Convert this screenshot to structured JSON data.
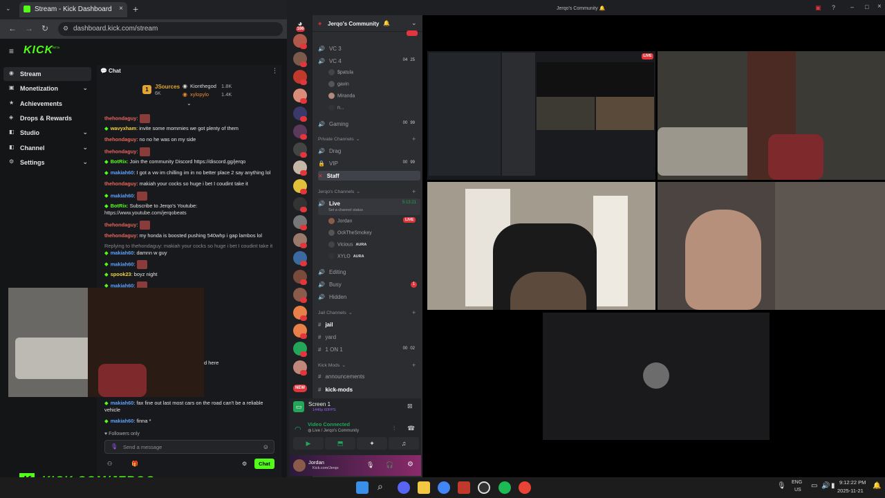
{
  "browser": {
    "tab_title": "Stream - Kick Dashboard",
    "url": "dashboard.kick.com/stream"
  },
  "kick": {
    "logo": "KICK",
    "beta": "BETA"
  },
  "nav": [
    {
      "label": "Stream",
      "icon": "stream-icon",
      "active": true
    },
    {
      "label": "Monetization",
      "icon": "money-icon",
      "chevron": true
    },
    {
      "label": "Achievements",
      "icon": "trophy-icon"
    },
    {
      "label": "Drops & Rewards",
      "icon": "gift-icon"
    },
    {
      "label": "Studio",
      "icon": "studio-icon",
      "chevron": true
    },
    {
      "label": "Channel",
      "icon": "channel-icon",
      "chevron": true
    },
    {
      "label": "Settings",
      "icon": "gear-icon",
      "chevron": true
    }
  ],
  "chat": {
    "title": "Chat",
    "leaderboard": {
      "rank": "1",
      "top_name": "JSources",
      "top_count": "6K",
      "user2": "Kionthegod",
      "user2_count": "1.8K",
      "user3": "xylopylo",
      "user3_count": "1.4K"
    },
    "messages": [
      {
        "user": "thehondaguy",
        "text": "",
        "color": "#e8655b",
        "emote": true
      },
      {
        "user": "wavyxham",
        "text": "invite some mommies we got plenty of them",
        "color": "#f0d040",
        "badge": true
      },
      {
        "user": "thehondaguy",
        "text": "no no he was on my side",
        "color": "#e8655b"
      },
      {
        "user": "thehondaguy",
        "text": "",
        "color": "#e8655b",
        "emote": true
      },
      {
        "user": "BotRix",
        "text": "Join the community Discord https://discord.gg/jerqo",
        "color": "#53fc18",
        "badge": true
      },
      {
        "user": "makiah60",
        "text": "I got a vw im chilling im in no better place 2 say anything lol",
        "color": "#5ba3ff",
        "badge": true
      },
      {
        "user": "thehondaguy",
        "text": "makiah your cocks so huge i bet I coudint take it",
        "color": "#e8655b"
      },
      {
        "user": "makiah60",
        "text": "",
        "color": "#5ba3ff",
        "badge": true,
        "emote": true
      },
      {
        "user": "BotRix",
        "text": "Subscribe to Jerqo's Youtube:",
        "color": "#53fc18",
        "badge": true
      },
      {
        "user": "",
        "text": "https://www.youtube.com/jerqobeats",
        "color": "#ddd"
      },
      {
        "user": "thehondaguy",
        "text": "",
        "color": "#e8655b",
        "emote": true
      },
      {
        "user": "thehondaguy",
        "text": "my honda is boosted pushing 540whp i gap lambos lol",
        "color": "#e8655b"
      },
      {
        "user": "",
        "text": "Replying to thehondaguy: makiah your cocks so huge i bet I coudint take it",
        "color": "#888"
      },
      {
        "user": "makiah60",
        "text": "damnn w guy",
        "color": "#5ba3ff",
        "badge": true
      },
      {
        "user": "makiah60",
        "text": "",
        "color": "#5ba3ff",
        "badge": true,
        "emote": true
      },
      {
        "user": "spook23",
        "text": "boyz night",
        "color": "#f0d040",
        "badge": true
      },
      {
        "user": "makiah60",
        "text": "",
        "color": "#5ba3ff",
        "badge": true,
        "emote": true
      }
    ],
    "partial_text": "d here",
    "bottom_messages": [
      {
        "user": "makiah60",
        "text": "fax fine out last most cars on the road can't be a reliable vehicle",
        "color": "#5ba3ff"
      },
      {
        "user": "makiah60",
        "text": "finna *",
        "color": "#5ba3ff"
      }
    ],
    "followers_only": "Followers only",
    "input_placeholder": "Send a message",
    "send_label": "Chat"
  },
  "watermark": "KICK.COM/JERQO",
  "discord": {
    "window_title": "Jerqo's Community",
    "server_name": "Jerqo's Community",
    "top_badge": "166",
    "channels_top": [
      {
        "name": "VC 3",
        "y": 69
      },
      {
        "name": "VC 4",
        "y": 87,
        "count": "04",
        "max": "25"
      }
    ],
    "vc4_users": [
      "$patula",
      "gavin",
      "Miranda",
      "n..."
    ],
    "gaming": {
      "name": "Gaming",
      "count": "00",
      "max": "99"
    },
    "private_cat": "Private Channels",
    "private": [
      {
        "name": "Drag"
      },
      {
        "name": "VIP",
        "count": "00",
        "max": "99"
      },
      {
        "name": "Staff"
      }
    ],
    "jerqo_cat": "Jerqo's Channels",
    "live": {
      "name": "Live",
      "timer": "5:13:21",
      "status": "Set a channel status"
    },
    "live_users": [
      {
        "name": "Jordan",
        "live": "LIVE"
      },
      {
        "name": "OckTheSmokey"
      },
      {
        "name": "Vicious",
        "tag": "AURA"
      },
      {
        "name": "XYLO",
        "tag": "AURA"
      }
    ],
    "jerqo_more": [
      {
        "name": "Editing"
      },
      {
        "name": "Busy",
        "badge": "1"
      },
      {
        "name": "Hidden"
      }
    ],
    "jail_cat": "Jail Channels",
    "jail": [
      {
        "name": "jail"
      },
      {
        "name": "yard"
      },
      {
        "name": "1 ON 1",
        "count": "00",
        "max": "02"
      }
    ],
    "mods_cat": "Kick Mods",
    "mods": [
      {
        "name": "announcements"
      },
      {
        "name": "kick-mods"
      }
    ],
    "screen": {
      "title": "Screen 1",
      "sub": "1440p 60FPS"
    },
    "voice": {
      "status": "Video Connected",
      "where": "Live / Jerqo's Community"
    },
    "user": {
      "name": "Jordan",
      "sub": "Kick.com/Jerqo"
    },
    "new_label": "NEW",
    "live_tile": "LIVE"
  },
  "taskbar": {
    "lang1": "ENG",
    "lang2": "US",
    "time": "9:12:22 PM",
    "date": "2025-11-21"
  },
  "colors": {
    "kick_green": "#53fc18",
    "discord_bg": "#2b2d31",
    "live_red": "#e0363c"
  }
}
